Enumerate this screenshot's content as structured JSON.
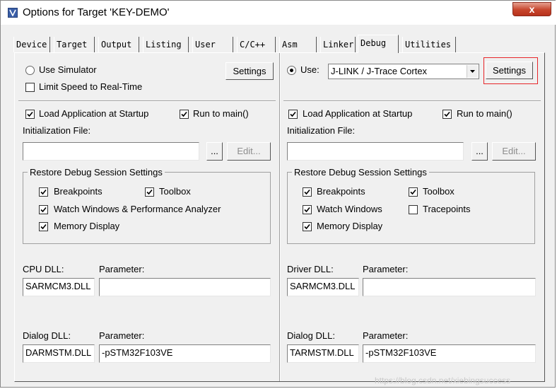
{
  "window": {
    "title": "Options for Target 'KEY-DEMO'",
    "close_label": "x"
  },
  "tabs": [
    "Device",
    "Target",
    "Output",
    "Listing",
    "User",
    "C/C++",
    "Asm",
    "Linker",
    "Debug",
    "Utilities"
  ],
  "active_tab": "Debug",
  "left": {
    "use_simulator_label": "Use Simulator",
    "use_simulator_checked": false,
    "settings_label": "Settings",
    "limit_speed_label": "Limit Speed to Real-Time",
    "limit_speed_checked": false,
    "load_app_label": "Load Application at Startup",
    "load_app_checked": true,
    "run_to_main_label": "Run to main()",
    "run_to_main_checked": true,
    "init_file_label": "Initialization File:",
    "init_file_value": "",
    "browse_label": "...",
    "edit_label": "Edit...",
    "restore_title": "Restore Debug Session Settings",
    "breakpoints_label": "Breakpoints",
    "toolbox_label": "Toolbox",
    "watch_label": "Watch Windows & Performance Analyzer",
    "memory_label": "Memory Display",
    "cpu_dll_label": "CPU DLL:",
    "cpu_param_label": "Parameter:",
    "cpu_dll_value": "SARMCM3.DLL",
    "cpu_param_value": "",
    "dialog_dll_label": "Dialog DLL:",
    "dialog_param_label": "Parameter:",
    "dialog_dll_value": "DARMSTM.DLL",
    "dialog_param_value": "-pSTM32F103VE"
  },
  "right": {
    "use_label": "Use:",
    "use_checked": true,
    "driver_value": "J-LINK / J-Trace Cortex",
    "settings_label": "Settings",
    "load_app_label": "Load Application at Startup",
    "run_to_main_label": "Run to main()",
    "init_file_label": "Initialization File:",
    "init_file_value": "",
    "browse_label": "...",
    "edit_label": "Edit...",
    "restore_title": "Restore Debug Session Settings",
    "breakpoints_label": "Breakpoints",
    "toolbox_label": "Toolbox",
    "watch_label": "Watch Windows",
    "tracepoints_label": "Tracepoints",
    "tracepoints_checked": false,
    "memory_label": "Memory Display",
    "driver_dll_label": "Driver DLL:",
    "driver_param_label": "Parameter:",
    "driver_dll_value": "SARMCM3.DLL",
    "driver_param_value": "",
    "dialog_dll_label": "Dialog DLL:",
    "dialog_param_label": "Parameter:",
    "dialog_dll_value": "TARMSTM.DLL",
    "dialog_param_value": "-pSTM32F103VE"
  },
  "watermark": "https://blog.csdn.net/xiebingsuccess",
  "colors": {
    "highlight": "#e8262a",
    "close": "#c7452c"
  }
}
